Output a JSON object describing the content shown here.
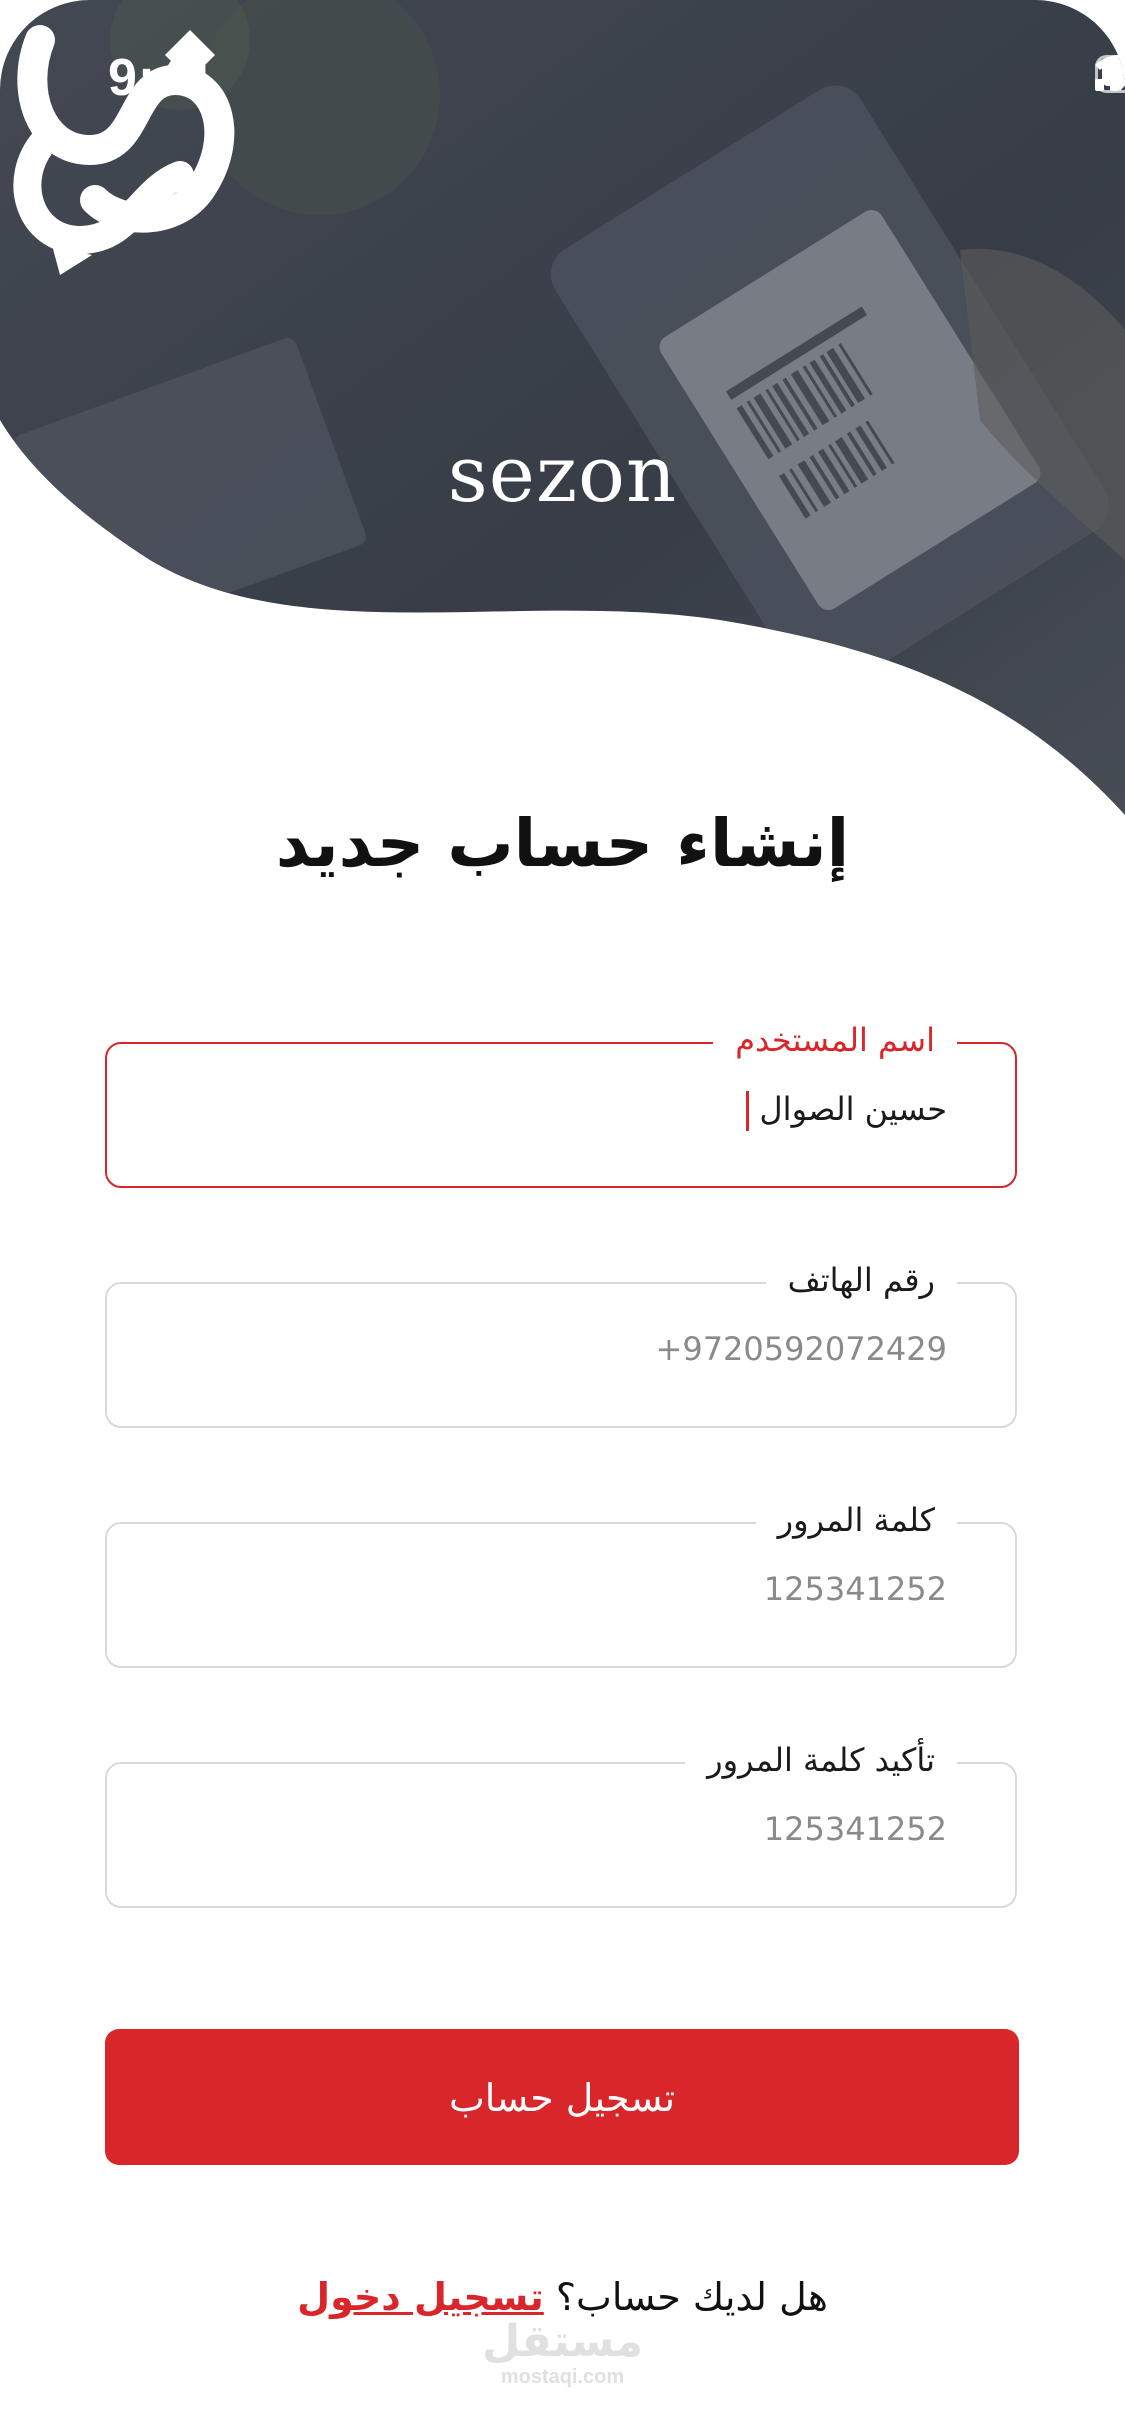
{
  "status_bar": {
    "time": "9:41",
    "icons": [
      "signal-icon",
      "wifi-icon",
      "battery-icon"
    ]
  },
  "brand": {
    "name": "sezon"
  },
  "page": {
    "title": "إنشاء حساب جديد"
  },
  "form": {
    "username": {
      "label": "اسم المستخدم",
      "value": "حسين الصوال"
    },
    "phone": {
      "label": "رقم الهاتف",
      "placeholder": "+9720592072429"
    },
    "password": {
      "label": "كلمة المرور",
      "placeholder": "125341252"
    },
    "confirm_password": {
      "label": "تأكيد كلمة المرور",
      "placeholder": "125341252"
    }
  },
  "register_button": {
    "label": "تسجيل حساب"
  },
  "footer": {
    "prompt": "هل لديك حساب؟",
    "login_link": "تسجيل دخول"
  },
  "watermark": {
    "arabic": "مستقل",
    "latin": "mostaqi.com"
  },
  "colors": {
    "accent": "#d9262a",
    "hero": "#3b414d",
    "border": "#d9d9d9"
  }
}
